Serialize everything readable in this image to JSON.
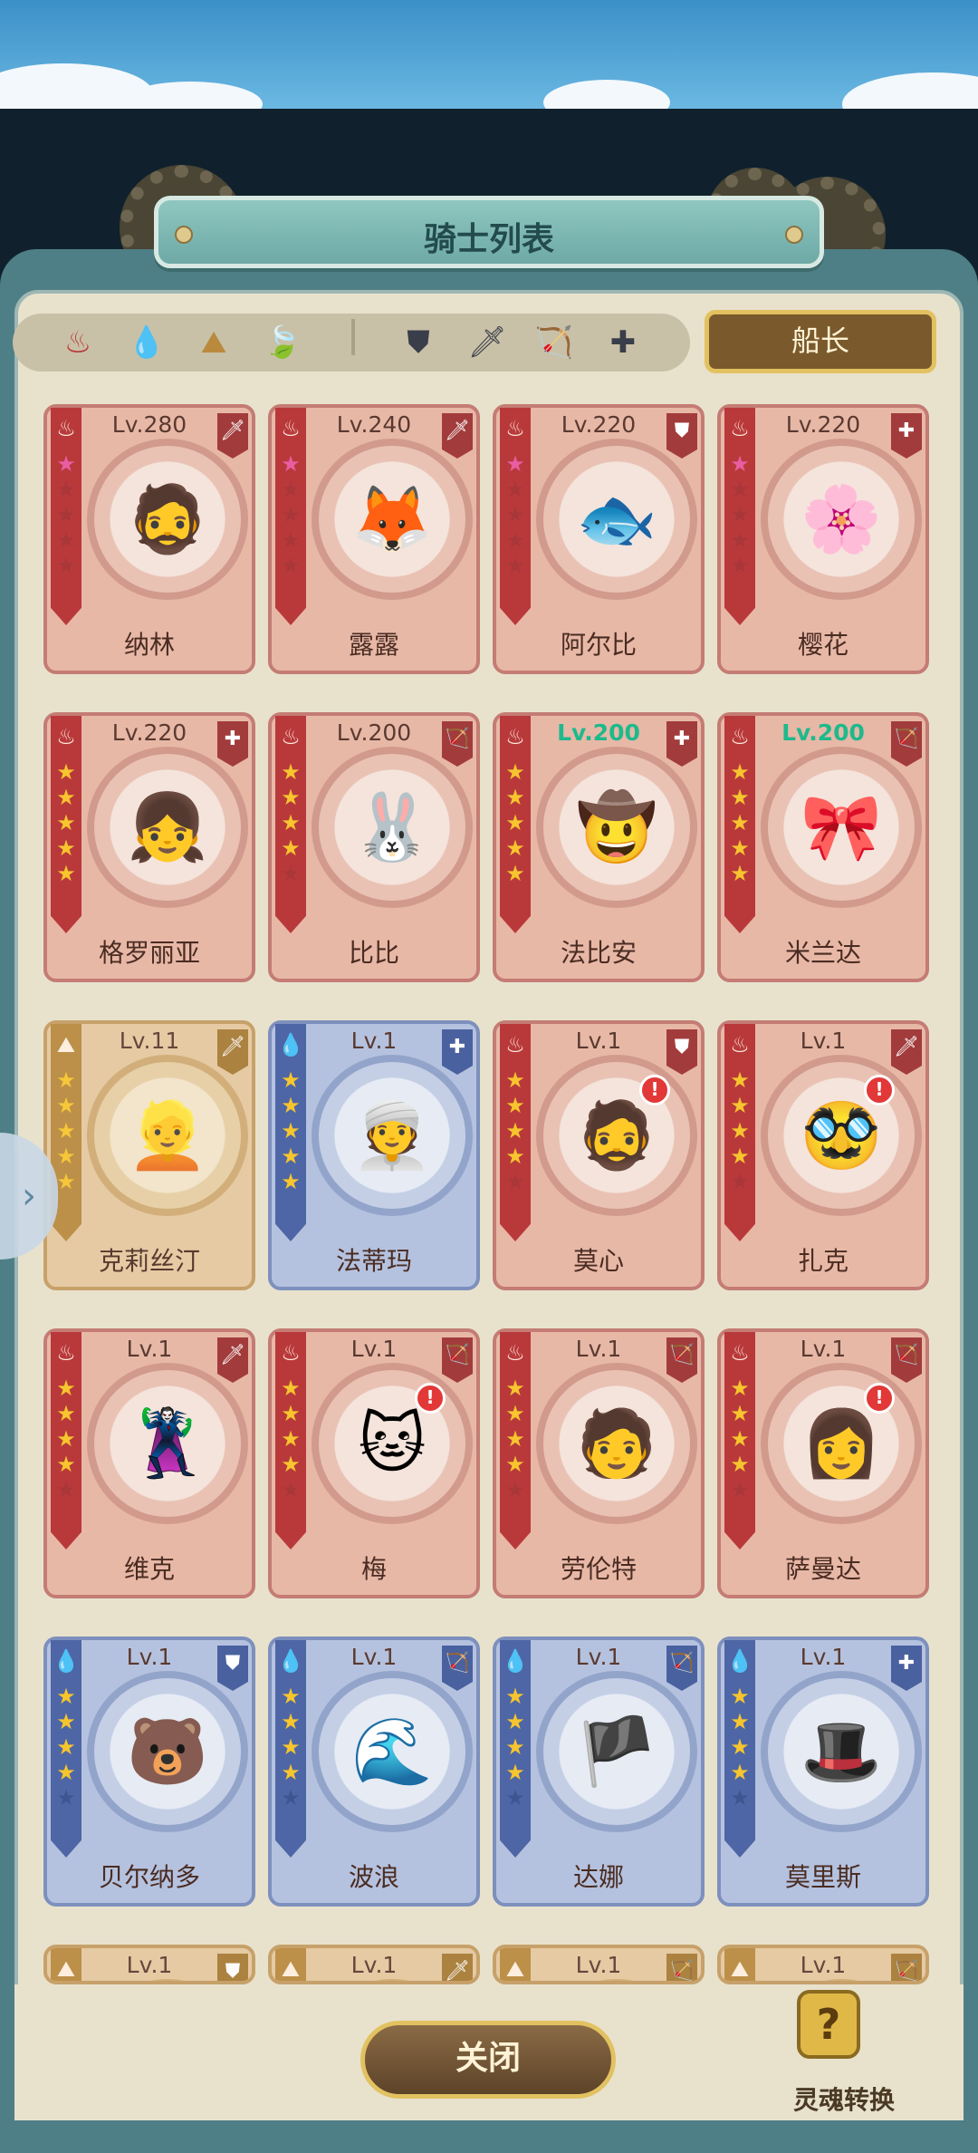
{
  "header": {
    "title": "骑士列表"
  },
  "filters": {
    "elements": [
      {
        "name": "fire",
        "glyph": "♨",
        "color": "#b9393b"
      },
      {
        "name": "water",
        "glyph": "💧",
        "color": "#4e66a5"
      },
      {
        "name": "earth",
        "glyph": "⛰",
        "color": "#b98a3e"
      },
      {
        "name": "wind",
        "glyph": "🍃",
        "color": "#6fa84e"
      }
    ],
    "classes": [
      {
        "name": "shield",
        "glyph": "⛊"
      },
      {
        "name": "sword",
        "glyph": "🗡"
      },
      {
        "name": "bow",
        "glyph": "🏹"
      },
      {
        "name": "healer",
        "glyph": "✚"
      }
    ],
    "captain_label": "船长"
  },
  "heroes": [
    {
      "name": "纳林",
      "level": "Lv.280",
      "element": "fire",
      "stars": 1,
      "star_type": "pink",
      "class_glyph": "🗡",
      "portrait": "🧔",
      "alert": false,
      "highlight": false
    },
    {
      "name": "露露",
      "level": "Lv.240",
      "element": "fire",
      "stars": 1,
      "star_type": "pink",
      "class_glyph": "🗡",
      "portrait": "🦊",
      "alert": false,
      "highlight": false
    },
    {
      "name": "阿尔比",
      "level": "Lv.220",
      "element": "fire",
      "stars": 1,
      "star_type": "pink",
      "class_glyph": "⛊",
      "portrait": "🐟",
      "alert": false,
      "highlight": false
    },
    {
      "name": "樱花",
      "level": "Lv.220",
      "element": "fire",
      "stars": 1,
      "star_type": "pink",
      "class_glyph": "✚",
      "portrait": "🌸",
      "alert": false,
      "highlight": false
    },
    {
      "name": "格罗丽亚",
      "level": "Lv.220",
      "element": "fire",
      "stars": 5,
      "star_type": "gold",
      "class_glyph": "✚",
      "portrait": "👧",
      "alert": false,
      "highlight": false
    },
    {
      "name": "比比",
      "level": "Lv.200",
      "element": "fire",
      "stars": 4,
      "star_type": "gold",
      "class_glyph": "🏹",
      "portrait": "🐰",
      "alert": false,
      "highlight": false
    },
    {
      "name": "法比安",
      "level": "Lv.200",
      "element": "fire",
      "stars": 5,
      "star_type": "gold",
      "class_glyph": "✚",
      "portrait": "🤠",
      "alert": false,
      "highlight": true
    },
    {
      "name": "米兰达",
      "level": "Lv.200",
      "element": "fire",
      "stars": 5,
      "star_type": "gold",
      "class_glyph": "🏹",
      "portrait": "🎀",
      "alert": false,
      "highlight": true
    },
    {
      "name": "克莉丝汀",
      "level": "Lv.11",
      "element": "earth",
      "stars": 5,
      "star_type": "gold",
      "class_glyph": "🗡",
      "portrait": "👱",
      "alert": false,
      "highlight": false
    },
    {
      "name": "法蒂玛",
      "level": "Lv.1",
      "element": "water",
      "stars": 5,
      "star_type": "gold",
      "class_glyph": "✚",
      "portrait": "👳",
      "alert": false,
      "highlight": false
    },
    {
      "name": "莫心",
      "level": "Lv.1",
      "element": "fire",
      "stars": 4,
      "star_type": "gold",
      "class_glyph": "⛊",
      "portrait": "🧔",
      "alert": true,
      "highlight": false
    },
    {
      "name": "扎克",
      "level": "Lv.1",
      "element": "fire",
      "stars": 4,
      "star_type": "gold",
      "class_glyph": "🗡",
      "portrait": "🥸",
      "alert": true,
      "highlight": false
    },
    {
      "name": "维克",
      "level": "Lv.1",
      "element": "fire",
      "stars": 4,
      "star_type": "gold",
      "class_glyph": "🗡",
      "portrait": "🦹",
      "alert": false,
      "highlight": false
    },
    {
      "name": "梅",
      "level": "Lv.1",
      "element": "fire",
      "stars": 4,
      "star_type": "gold",
      "class_glyph": "🏹",
      "portrait": "🐱",
      "alert": true,
      "highlight": false
    },
    {
      "name": "劳伦特",
      "level": "Lv.1",
      "element": "fire",
      "stars": 4,
      "star_type": "gold",
      "class_glyph": "🏹",
      "portrait": "🧑",
      "alert": false,
      "highlight": false
    },
    {
      "name": "萨曼达",
      "level": "Lv.1",
      "element": "fire",
      "stars": 4,
      "star_type": "gold",
      "class_glyph": "🏹",
      "portrait": "👩",
      "alert": true,
      "highlight": false
    },
    {
      "name": "贝尔纳多",
      "level": "Lv.1",
      "element": "water",
      "stars": 4,
      "star_type": "gold",
      "class_glyph": "⛊",
      "portrait": "🐻",
      "alert": false,
      "highlight": false
    },
    {
      "name": "波浪",
      "level": "Lv.1",
      "element": "water",
      "stars": 4,
      "star_type": "gold",
      "class_glyph": "🏹",
      "portrait": "🌊",
      "alert": false,
      "highlight": false
    },
    {
      "name": "达娜",
      "level": "Lv.1",
      "element": "water",
      "stars": 4,
      "star_type": "gold",
      "class_glyph": "🏹",
      "portrait": "🏴",
      "alert": false,
      "highlight": false
    },
    {
      "name": "莫里斯",
      "level": "Lv.1",
      "element": "water",
      "stars": 4,
      "star_type": "gold",
      "class_glyph": "✚",
      "portrait": "🎩",
      "alert": false,
      "highlight": false
    },
    {
      "name": "",
      "level": "Lv.1",
      "element": "earth",
      "stars": 0,
      "star_type": "gold",
      "class_glyph": "⛊",
      "portrait": "",
      "alert": false,
      "highlight": false
    },
    {
      "name": "",
      "level": "Lv.1",
      "element": "earth",
      "stars": 0,
      "star_type": "gold",
      "class_glyph": "🗡",
      "portrait": "",
      "alert": false,
      "highlight": false
    },
    {
      "name": "",
      "level": "Lv.1",
      "element": "earth",
      "stars": 0,
      "star_type": "gold",
      "class_glyph": "🏹",
      "portrait": "",
      "alert": false,
      "highlight": false
    },
    {
      "name": "",
      "level": "Lv.1",
      "element": "earth",
      "stars": 0,
      "star_type": "gold",
      "class_glyph": "🏹",
      "portrait": "",
      "alert": false,
      "highlight": false
    }
  ],
  "footer": {
    "close_label": "关闭",
    "soul_label": "灵魂转换",
    "soul_glyph": "?"
  },
  "side_arrow_glyph": "›",
  "element_glyphs": {
    "fire": "♨",
    "water": "💧",
    "earth": "⛰"
  }
}
